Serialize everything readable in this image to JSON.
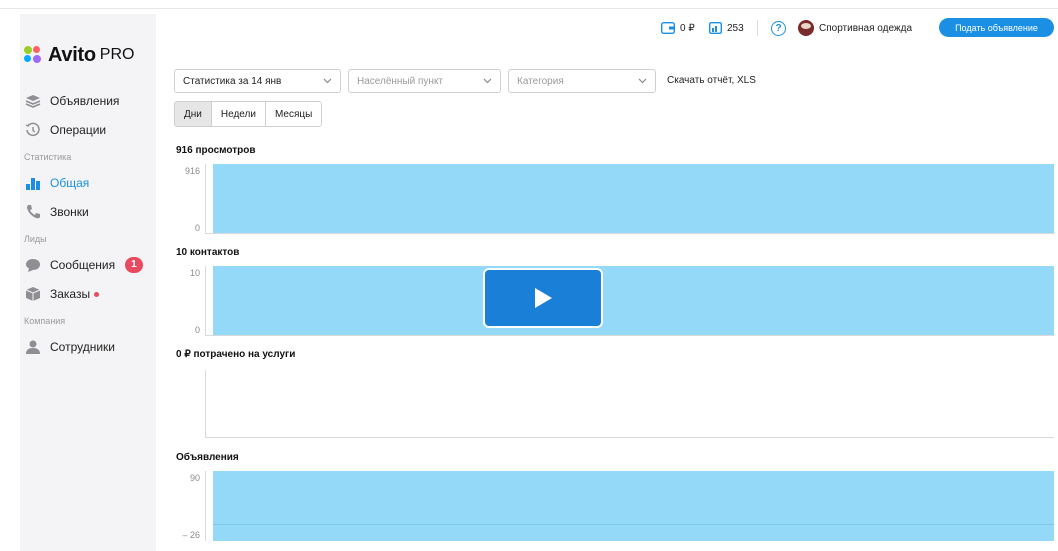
{
  "sidebar": {
    "logo": {
      "brand": "Avito",
      "suffix": "PRO",
      "colors": [
        "#97cf26",
        "#ff6163",
        "#0af",
        "#a169f7"
      ]
    },
    "items": [
      {
        "label": "Объявления",
        "icon": "stack-icon"
      },
      {
        "label": "Операции",
        "icon": "history-icon"
      },
      {
        "label": "Общая",
        "icon": "bar-chart-icon"
      },
      {
        "label": "Звонки",
        "icon": "phone-icon"
      },
      {
        "label": "Сообщения",
        "icon": "chat-icon",
        "badge": "1"
      },
      {
        "label": "Заказы",
        "icon": "box-icon"
      },
      {
        "label": "Сотрудники",
        "icon": "user-icon"
      }
    ],
    "sections": {
      "stats": "Статистика",
      "leads": "Лиды",
      "company": "Компания"
    }
  },
  "topbar": {
    "wallet": "0 ₽",
    "listings_count": "253",
    "help": "?",
    "account_name": "Спортивная одежда",
    "post_button": "Подать объявление"
  },
  "filters": {
    "period": "Статистика за 14 янв",
    "city_placeholder": "Населённый пункт",
    "category_placeholder": "Категория",
    "download": "Скачать отчёт, XLS"
  },
  "tabs": [
    "Дни",
    "Недели",
    "Месяцы"
  ],
  "charts": {
    "views": {
      "title": "916 просмотров",
      "ticks": [
        "916",
        "0"
      ]
    },
    "contacts": {
      "title": "10 контактов",
      "ticks": [
        "10",
        "0"
      ]
    },
    "spent": {
      "title": "0 ₽ потрачено на услуги"
    },
    "listings": {
      "title": "Объявления",
      "ticks": [
        "90",
        "– 26"
      ]
    }
  },
  "colors": {
    "accent": "#1a8fe3",
    "bar": "#95d9f8",
    "badge": "#e84a5f"
  }
}
